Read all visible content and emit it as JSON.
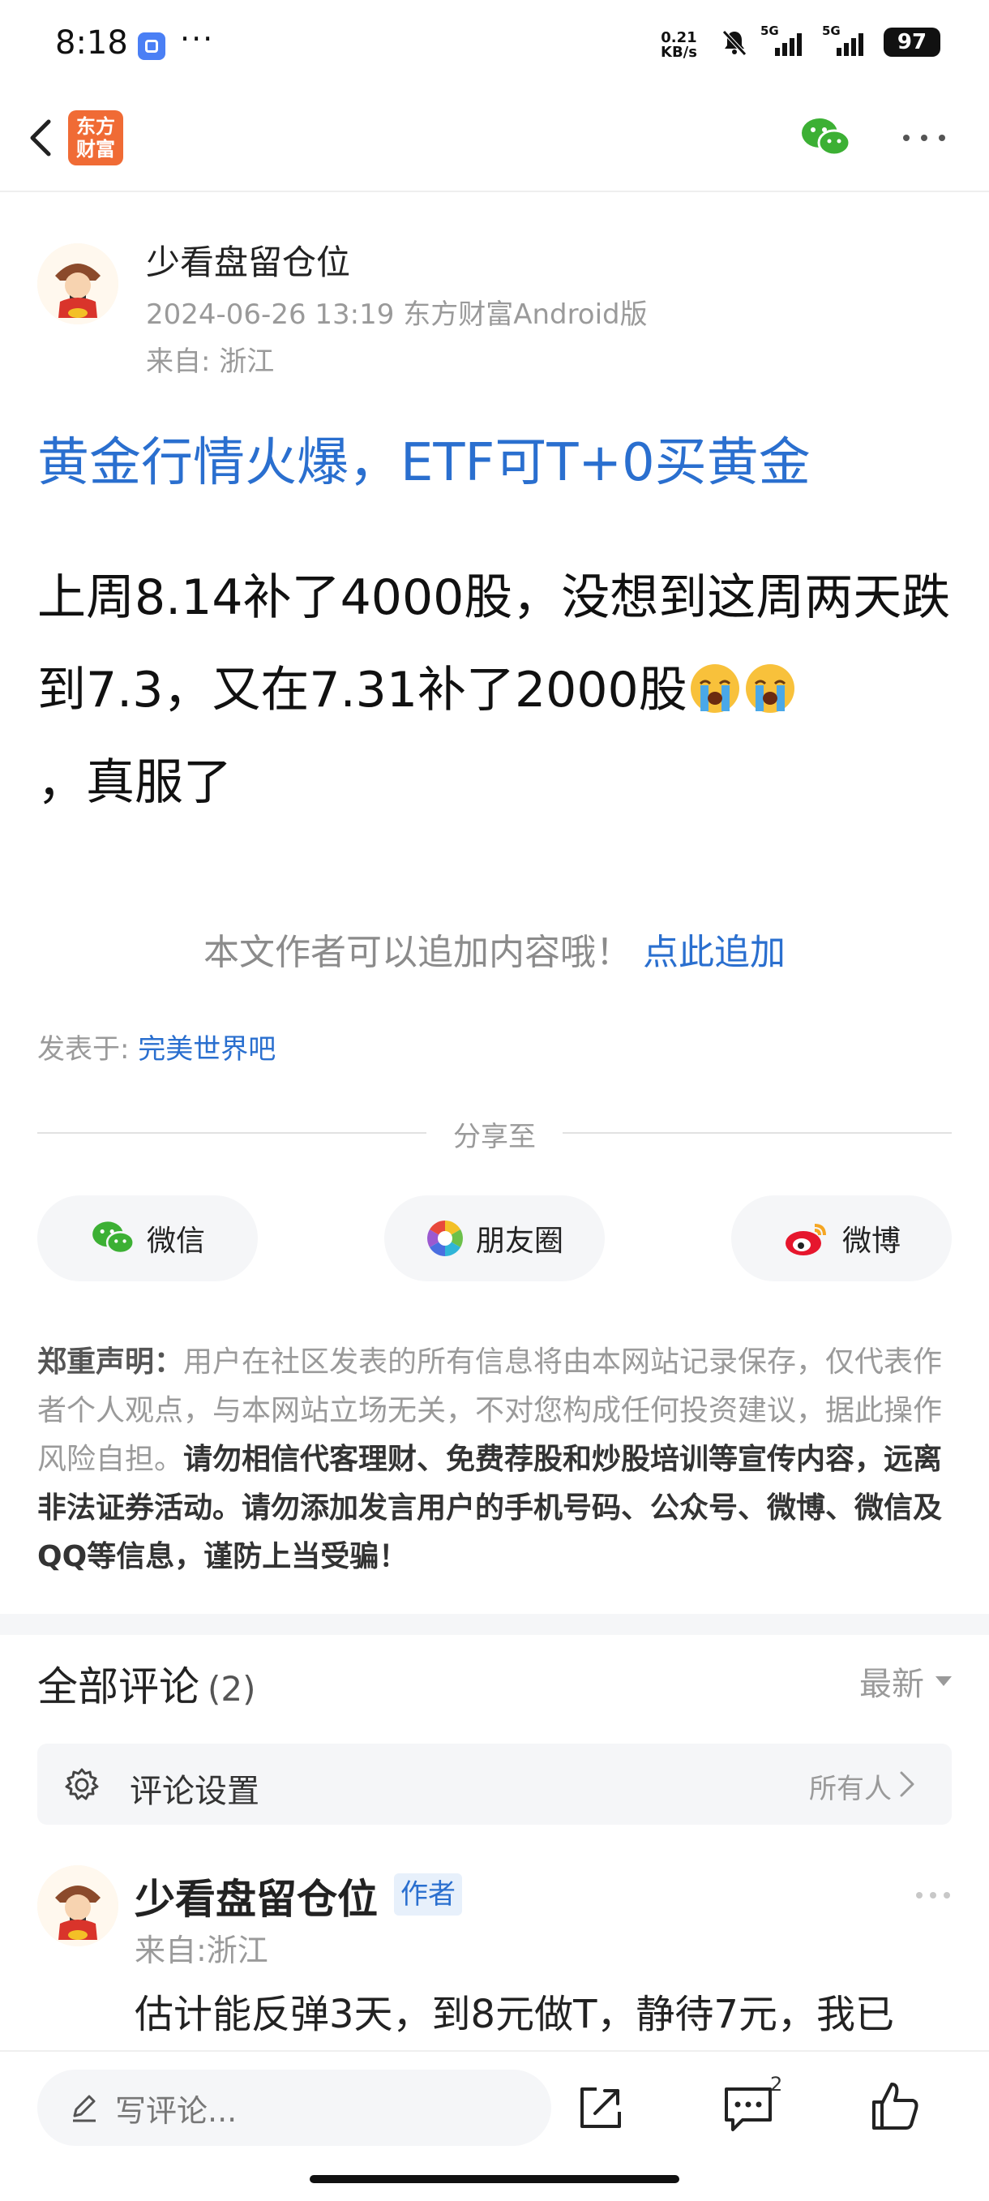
{
  "status_bar": {
    "time": "8:18",
    "more": "···",
    "net_speed": "0.21",
    "net_unit": "KB/s",
    "sim1": "5G",
    "sim2": "5G",
    "battery": "97"
  },
  "nav": {
    "logo_line1": "东方",
    "logo_line2": "财富",
    "icons": [
      "back-icon",
      "wechat-icon",
      "more-icon"
    ]
  },
  "post": {
    "author": "少看盘留仓位",
    "meta": "2024-06-26 13:19 东方财富Android版",
    "from": "来自: 浙江",
    "title": "黄金行情火爆，ETF可T+0买黄金",
    "body_part1": "上周8.14补了4000股，没想到这周两天跌到7.3，又在7.31补了2000股",
    "body_part2": "，真服了",
    "add_hint": "本文作者可以追加内容哦！",
    "add_link": "点此追加",
    "posted_in_label": "发表于:",
    "posted_in_value": "完美世界吧"
  },
  "share": {
    "label": "分享至",
    "buttons": [
      "微信",
      "朋友圈",
      "微博"
    ]
  },
  "disclaimer": {
    "title": "郑重声明：",
    "normal": "用户在社区发表的所有信息将由本网站记录保存，仅代表作者个人观点，与本网站立场无关，不对您构成任何投资建议，据此操作风险自担。",
    "bold": "请勿相信代客理财、免费荐股和炒股培训等宣传内容，远离非法证券活动。请勿添加发言用户的手机号码、公众号、微博、微信及QQ等信息，谨防上当受骗！"
  },
  "comments": {
    "title": "全部评论",
    "count": "(2)",
    "sort": "最新",
    "settings_label": "评论设置",
    "settings_value": "所有人",
    "items": [
      {
        "name": "少看盘留仓位",
        "badge": "作者",
        "from": "来自:浙江",
        "text": "估计能反弹3天，到8元做T，静待7元，我已"
      }
    ]
  },
  "bottom_bar": {
    "write_placeholder": "写评论...",
    "comment_count": "2"
  },
  "colors": {
    "accent_blue": "#2a6fcf",
    "brand_orange": "#f06b35",
    "wechat_green": "#3cb034",
    "weibo_red": "#e6162d"
  }
}
